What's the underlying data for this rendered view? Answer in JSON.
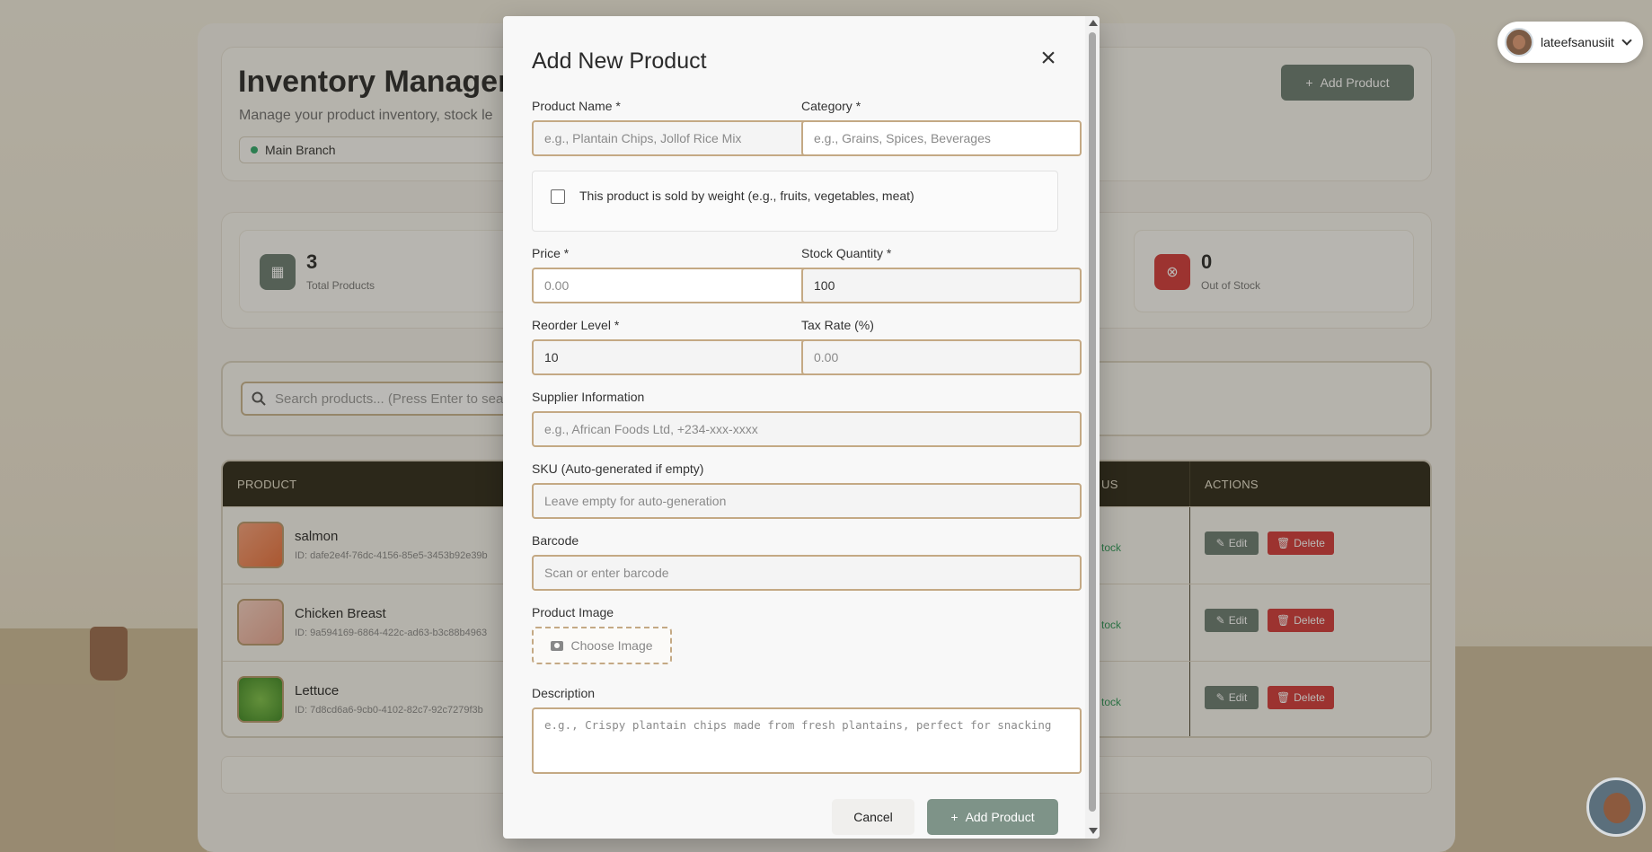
{
  "user_menu": {
    "username": "lateefsanusiit"
  },
  "header": {
    "title": "Inventory Manager",
    "subtitle": "Manage your product inventory, stock le",
    "branch": "Main Branch",
    "add_button": "Add Product"
  },
  "stats": [
    {
      "value": "3",
      "label": "Total Products",
      "icon": "boxes-icon",
      "color": "#6b7c72"
    },
    {
      "value": "0",
      "label": "Out of Stock",
      "icon": "x-circle-icon",
      "color": "#d33a3a"
    }
  ],
  "search": {
    "placeholder": "Search products... (Press Enter to searc"
  },
  "table": {
    "headers": {
      "product": "PRODUCT",
      "status": "US",
      "actions": "ACTIONS"
    },
    "rows": [
      {
        "name": "salmon",
        "id": "ID: dafe2e4f-76dc-4156-85e5-3453b92e39b",
        "status": "tock",
        "edit": "Edit",
        "delete": "Delete"
      },
      {
        "name": "Chicken Breast",
        "id": "ID: 9a594169-6864-422c-ad63-b3c88b4963",
        "status": "tock",
        "edit": "Edit",
        "delete": "Delete"
      },
      {
        "name": "Lettuce",
        "id": "ID: 7d8cd6a6-9cb0-4102-82c7-92c7279f3b",
        "status": "tock",
        "edit": "Edit",
        "delete": "Delete"
      }
    ]
  },
  "modal": {
    "title": "Add New Product",
    "fields": {
      "product_name": {
        "label": "Product Name *",
        "placeholder": "e.g., Plantain Chips, Jollof Rice Mix"
      },
      "category": {
        "label": "Category *",
        "placeholder": "e.g., Grains, Spices, Beverages"
      },
      "sold_by_weight": {
        "label": "This product is sold by weight (e.g., fruits, vegetables, meat)",
        "checked": false
      },
      "price": {
        "label": "Price *",
        "placeholder": "0.00"
      },
      "stock_quantity": {
        "label": "Stock Quantity *",
        "value": "100"
      },
      "reorder_level": {
        "label": "Reorder Level *",
        "value": "10"
      },
      "tax_rate": {
        "label": "Tax Rate (%)",
        "placeholder": "0.00"
      },
      "supplier": {
        "label": "Supplier Information",
        "placeholder": "e.g., African Foods Ltd, +234-xxx-xxxx"
      },
      "sku": {
        "label": "SKU (Auto-generated if empty)",
        "placeholder": "Leave empty for auto-generation"
      },
      "barcode": {
        "label": "Barcode",
        "placeholder": "Scan or enter barcode"
      },
      "product_image": {
        "label": "Product Image",
        "button": "Choose Image"
      },
      "description": {
        "label": "Description",
        "placeholder": "e.g., Crispy plantain chips made from fresh plantains, perfect for snacking"
      }
    },
    "cancel_label": "Cancel",
    "submit_label": "Add Product"
  }
}
